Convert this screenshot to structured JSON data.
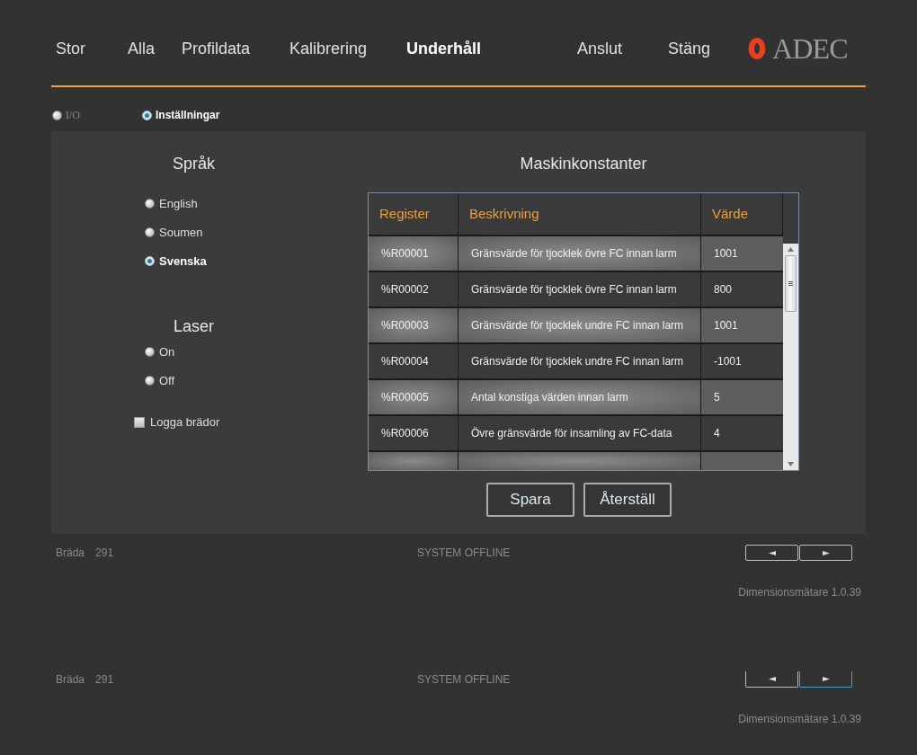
{
  "nav": {
    "tabs": [
      {
        "label": "Stor",
        "selected": false
      },
      {
        "label": "Alla",
        "selected": false
      },
      {
        "label": "Profildata",
        "selected": false
      },
      {
        "label": "Kalibrering",
        "selected": false
      },
      {
        "label": "Underhåll",
        "selected": true
      }
    ],
    "actions": [
      "Anslut",
      "Stäng"
    ],
    "logo": "ADEC"
  },
  "subtabs": [
    {
      "label": "I/O",
      "selected": false
    },
    {
      "label": "Inställningar",
      "selected": true
    }
  ],
  "language": {
    "title": "Språk",
    "options": [
      {
        "label": "English",
        "selected": false
      },
      {
        "label": "Soumen",
        "selected": false
      },
      {
        "label": "Svenska",
        "selected": true
      }
    ]
  },
  "laser": {
    "title": "Laser",
    "options": [
      {
        "label": "On",
        "selected": false
      },
      {
        "label": "Off",
        "selected": false
      }
    ]
  },
  "log_boards": {
    "label": "Logga brädor",
    "checked": false
  },
  "constants": {
    "title": "Maskinkonstanter",
    "columns": [
      "Register",
      "Beskrivning",
      "Värde"
    ],
    "rows": [
      {
        "register": "%R00001",
        "description": "Gränsvärde för tjocklek övre FC innan larm",
        "value": "1001"
      },
      {
        "register": "%R00002",
        "description": "Gränsvärde för tjocklek övre FC innan larm",
        "value": "800"
      },
      {
        "register": "%R00003",
        "description": "Gränsvärde för tjocklek undre FC innan larm",
        "value": "1001"
      },
      {
        "register": "%R00004",
        "description": "Gränsvärde för tjocklek undre FC innan larm",
        "value": "-1001"
      },
      {
        "register": "%R00005",
        "description": "Antal konstiga värden innan larm",
        "value": "5"
      },
      {
        "register": "%R00006",
        "description": "Övre gränsvärde för insamling av FC-data",
        "value": "4"
      }
    ],
    "buttons": [
      "Spara",
      "Återställ"
    ]
  },
  "footers": [
    {
      "board_label": "Bräda",
      "board_value": "291",
      "status": "SYSTEM OFFLINE",
      "version": "Dimensionsmätare 1.0.39",
      "nav_buttons": [
        {
          "selected": false
        },
        {
          "selected": false
        }
      ]
    },
    {
      "board_label": "Bräda",
      "board_value": "291",
      "status": "SYSTEM OFFLINE",
      "version": "Dimensionsmätare 1.0.39",
      "nav_buttons": [
        {
          "selected": false
        },
        {
          "selected": true
        }
      ]
    }
  ]
}
